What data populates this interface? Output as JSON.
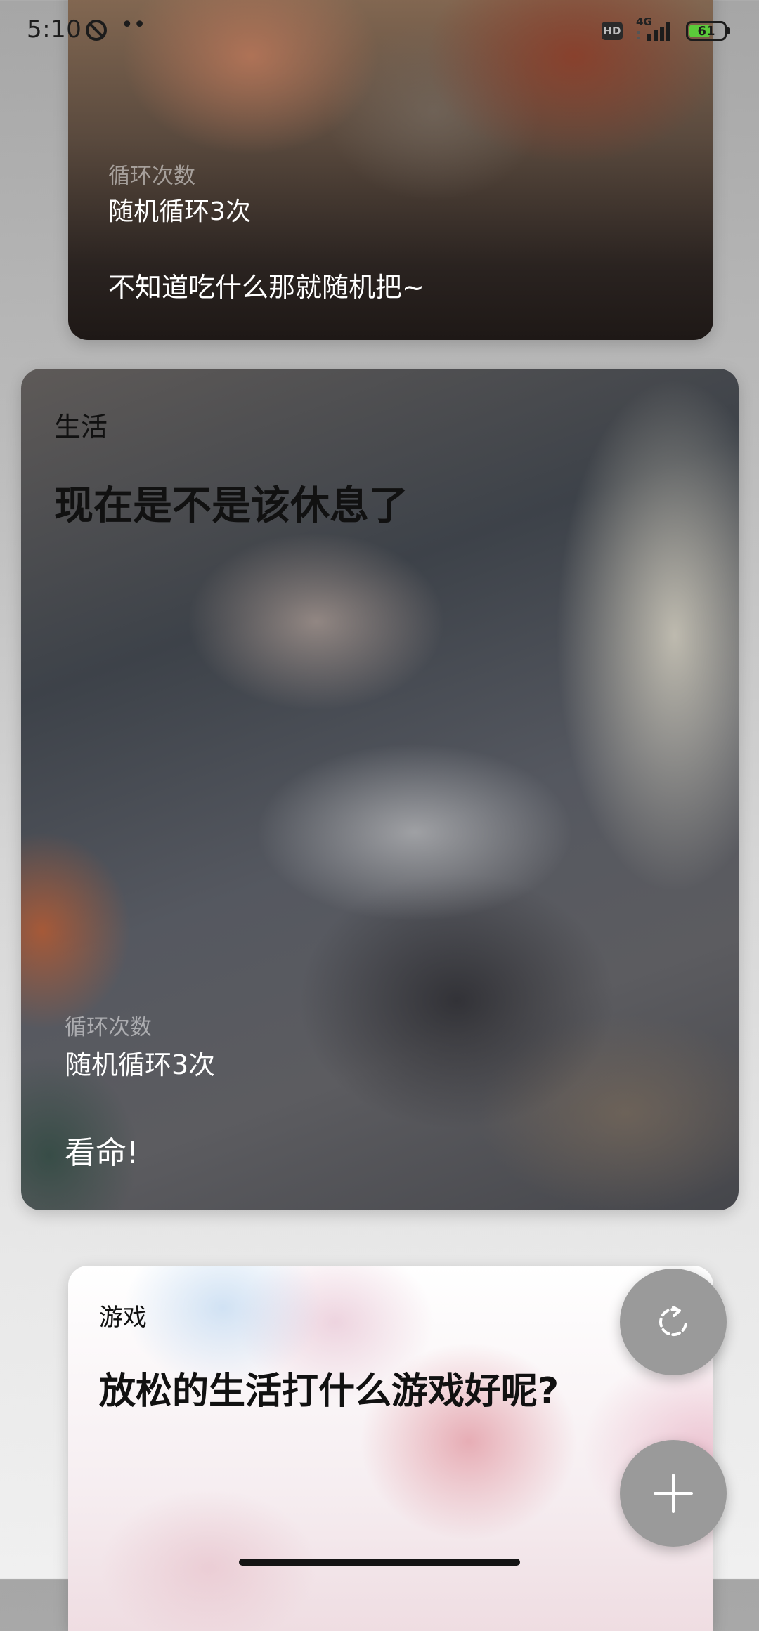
{
  "status_bar": {
    "time": "5:10",
    "dots": "••",
    "hd_badge": "HD",
    "network": "4G",
    "battery": "61",
    "battery_level": 0.61,
    "battery_color": "#5bcb3a"
  },
  "cards": [
    {
      "loop_label": "循环次数",
      "loop_value": "随机循环3次",
      "description": "不知道吃什么那就随机把~"
    },
    {
      "category": "生活",
      "title": "现在是不是该休息了",
      "loop_label": "循环次数",
      "loop_value": "随机循环3次",
      "description": "看命!"
    },
    {
      "category": "游戏",
      "title": "放松的生活打什么游戏好呢?"
    }
  ],
  "fabs": {
    "shuffle_icon": "refresh-icon",
    "add_icon": "plus-icon",
    "color": "#9a9a9a"
  }
}
